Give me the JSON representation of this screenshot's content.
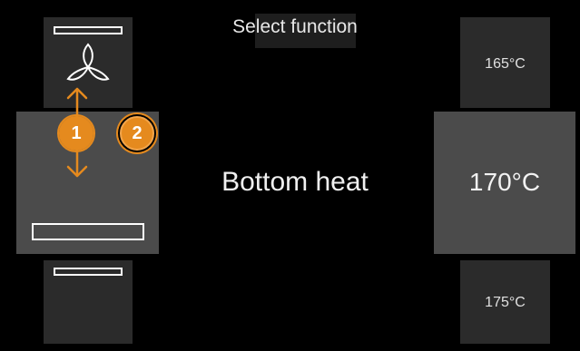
{
  "header": {
    "title": "Select function"
  },
  "functions": {
    "previous": {
      "icon": "fan-heater-icon"
    },
    "current": {
      "label": "Bottom heat",
      "icon": "bottom-heater-icon"
    },
    "next": {
      "icon": "top-heater-icon"
    }
  },
  "temperatures": {
    "previous": "165°C",
    "current": "170°C",
    "next": "175°C"
  },
  "callouts": [
    {
      "label": "1",
      "icon": "up-down-arrow-icon"
    },
    {
      "label": "2"
    }
  ],
  "colors": {
    "accent": "#e58a1e",
    "selected_tile": "#4b4b4b",
    "tile": "#2b2b2b",
    "background": "#000000"
  }
}
